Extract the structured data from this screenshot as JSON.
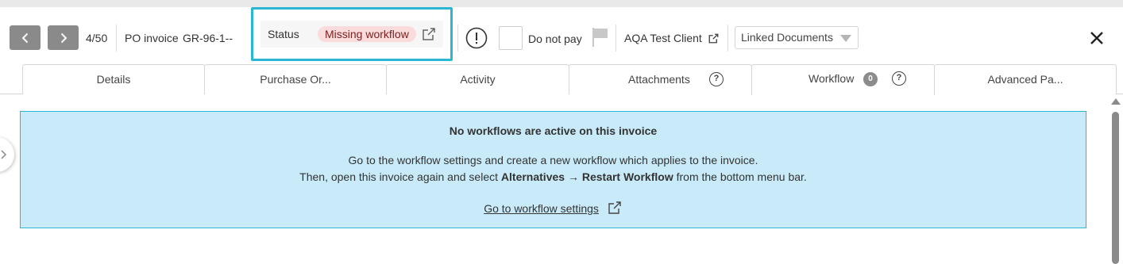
{
  "header": {
    "counter": "4/50",
    "doc_type": "PO invoice",
    "doc_number": "GR-96-1--",
    "status_label": "Status",
    "status_value": "Missing workflow",
    "do_not_pay_label": "Do not pay",
    "client_name": "AQA Test Client",
    "linked_documents_label": "Linked Documents"
  },
  "tabs": [
    {
      "label": "Details"
    },
    {
      "label": "Purchase Or..."
    },
    {
      "label": "Activity"
    },
    {
      "label": "Attachments",
      "help": "?"
    },
    {
      "label": "Workflow",
      "badge": "0",
      "help": "?"
    },
    {
      "label": "Advanced Pa..."
    }
  ],
  "info": {
    "title": "No workflows are active on this invoice",
    "line1": "Go to the workflow settings and create a new workflow which applies to the invoice.",
    "line2_pre": "Then, open this invoice again and select ",
    "line2_bold1": "Alternatives",
    "line2_arrow": " → ",
    "line2_bold2": "Restart Workflow",
    "line2_post": " from the bottom menu bar.",
    "link_label": "Go to workflow settings"
  },
  "colors": {
    "accent": "#29b7d3",
    "info_bg": "#c9ebf9",
    "status_pill_bg": "#fbdcdc",
    "nav_button": "#8a8a8a"
  },
  "icons": {
    "prev": "chevron-left-icon",
    "next": "chevron-right-icon",
    "status_open": "external-link-icon",
    "warning": "exclamation-circle-icon",
    "flag": "flag-icon",
    "client_open": "external-link-icon",
    "close": "close-icon"
  }
}
